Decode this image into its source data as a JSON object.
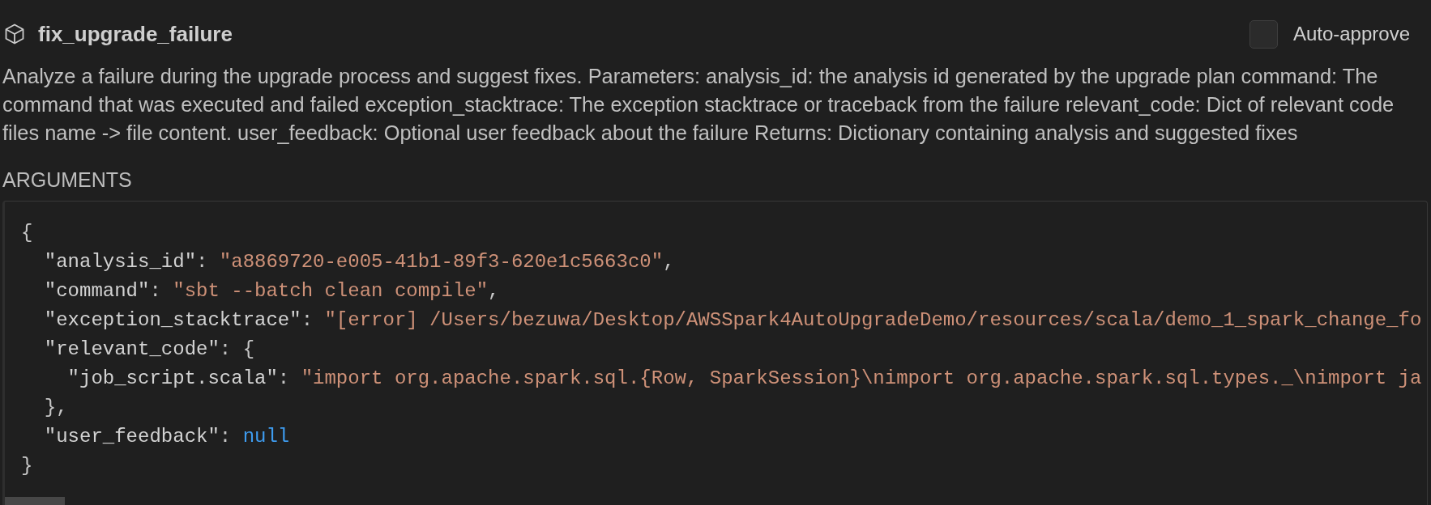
{
  "tool": {
    "name": "fix_upgrade_failure",
    "auto_approve": {
      "label": "Auto-approve",
      "checked": false
    },
    "description": "Analyze a failure during the upgrade process and suggest fixes. Parameters: analysis_id: the analysis id generated by the upgrade plan command: The command that was executed and failed exception_stacktrace: The exception stacktrace or traceback from the failure relevant_code: Dict of relevant code files name -> file content. user_feedback: Optional user feedback about the failure Returns: Dictionary containing analysis and suggested fixes"
  },
  "arguments": {
    "label": "ARGUMENTS",
    "lines": [
      {
        "tokens": [
          {
            "kind": "punct",
            "text": "{"
          }
        ],
        "children": [
          {
            "tokens": [
              {
                "kind": "key",
                "text": "\"analysis_id\""
              },
              {
                "kind": "punct",
                "text": ": "
              },
              {
                "kind": "string",
                "text": "\"a8869720-e005-41b1-89f3-620e1c5663c0\""
              },
              {
                "kind": "punct",
                "text": ","
              }
            ]
          },
          {
            "tokens": [
              {
                "kind": "key",
                "text": "\"command\""
              },
              {
                "kind": "punct",
                "text": ": "
              },
              {
                "kind": "string",
                "text": "\"sbt --batch clean compile\""
              },
              {
                "kind": "punct",
                "text": ","
              }
            ]
          },
          {
            "tokens": [
              {
                "kind": "key",
                "text": "\"exception_stacktrace\""
              },
              {
                "kind": "punct",
                "text": ": "
              },
              {
                "kind": "string",
                "text": "\"[error] /Users/bezuwa/Desktop/AWSSpark4AutoUpgradeDemo/resources/scala/demo_1_spark_change_fo"
              }
            ]
          },
          {
            "tokens": [
              {
                "kind": "key",
                "text": "\"relevant_code\""
              },
              {
                "kind": "punct",
                "text": ": {"
              }
            ],
            "children": [
              {
                "tokens": [
                  {
                    "kind": "key",
                    "text": "\"job_script.scala\""
                  },
                  {
                    "kind": "punct",
                    "text": ": "
                  },
                  {
                    "kind": "string",
                    "text": "\"import org.apache.spark.sql.{Row, SparkSession}\\nimport org.apache.spark.sql.types._\\nimport ja"
                  }
                ]
              }
            ]
          },
          {
            "tokens": [
              {
                "kind": "punct",
                "text": "},"
              }
            ]
          },
          {
            "tokens": [
              {
                "kind": "key",
                "text": "\"user_feedback\""
              },
              {
                "kind": "punct",
                "text": ": "
              },
              {
                "kind": "null",
                "text": "null"
              }
            ]
          }
        ]
      },
      {
        "tokens": [
          {
            "kind": "punct",
            "text": "}"
          }
        ]
      }
    ]
  }
}
